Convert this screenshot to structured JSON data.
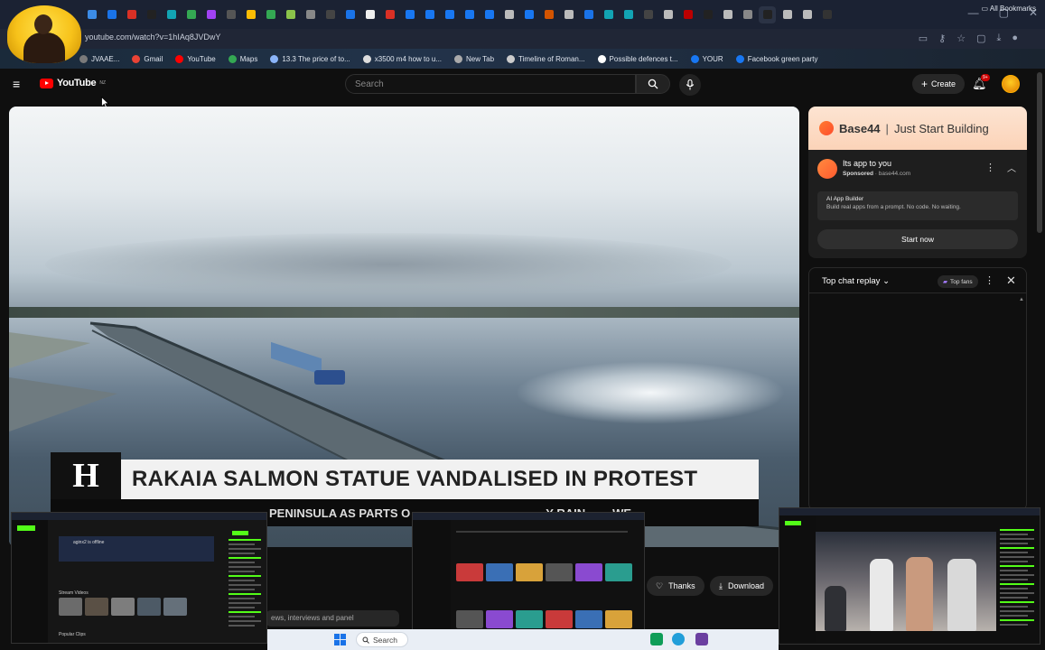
{
  "browser": {
    "url": "youtube.com/watch?v=1hIAq8JVDwY",
    "bookmarks": [
      {
        "label": "JVAAE...",
        "color": "#7a7a7a"
      },
      {
        "label": "Gmail",
        "color": "#ea4335"
      },
      {
        "label": "YouTube",
        "color": "#ff0000"
      },
      {
        "label": "Maps",
        "color": "#34a853"
      },
      {
        "label": "13.3 The price of to...",
        "color": "#8ab4f8"
      },
      {
        "label": "x3500 m4 how to u...",
        "color": "#dddddd"
      },
      {
        "label": "New Tab",
        "color": "#aaaaaa"
      },
      {
        "label": "Timeline of Roman...",
        "color": "#cccccc"
      },
      {
        "label": "Possible defences t...",
        "color": "#ffffff"
      },
      {
        "label": "YOUR",
        "color": "#1877f2"
      },
      {
        "label": "Facebook green party",
        "color": "#1877f2"
      }
    ],
    "all_bookmarks": "All Bookmarks",
    "tab_colors": [
      "#3c8ce7",
      "#1a73e8",
      "#d93025",
      "#222",
      "#12a4b3",
      "#34a853",
      "#a142f4",
      "#555",
      "#fbbc04",
      "#34a853",
      "#8bc34a",
      "#888",
      "#444",
      "#1a73e8",
      "#eee",
      "#d93025",
      "#1877f2",
      "#1877f2",
      "#1877f2",
      "#1877f2",
      "#1877f2",
      "#bbb",
      "#1877f2",
      "#d35400",
      "#bbb",
      "#1a73e8",
      "#12a4b3",
      "#12a4b3",
      "#444",
      "#bbb",
      "#b00",
      "#222",
      "#bbb",
      "#888",
      "#222",
      "#bbb",
      "#bbb",
      "#333"
    ]
  },
  "youtube": {
    "logo_text": "YouTube",
    "logo_region": "NZ",
    "search_placeholder": "Search",
    "create_label": "Create",
    "notification_count": "9+"
  },
  "video": {
    "headline": "RAKAIA SALMON STATUE VANDALISED IN PROTEST",
    "ticker": "PENINSULA AS PARTS O",
    "ticker_tail": "Y RAIN",
    "ticker_end": "WE",
    "logo_glyph": "H"
  },
  "actions": {
    "thanks_label": "Thanks",
    "download_label": "Download",
    "description_snippet": "ews, interviews and panel"
  },
  "ad": {
    "brand": "Base44",
    "tagline": "Just Start Building",
    "title": "Its app to you",
    "sponsored": "Sponsored",
    "domain": "base44.com",
    "inner_title": "AI App Builder",
    "inner_desc": "Build real apps from a prompt. No code. No waiting.",
    "cta": "Start now"
  },
  "chat": {
    "title": "Top chat replay",
    "fans_label": "Top fans"
  },
  "taskbar": {
    "search_label": "Search"
  },
  "stream_overlays": {
    "left_title": "Popular Clips",
    "left_status": "aginx2 is offline",
    "left_section": "Stream Videos"
  }
}
